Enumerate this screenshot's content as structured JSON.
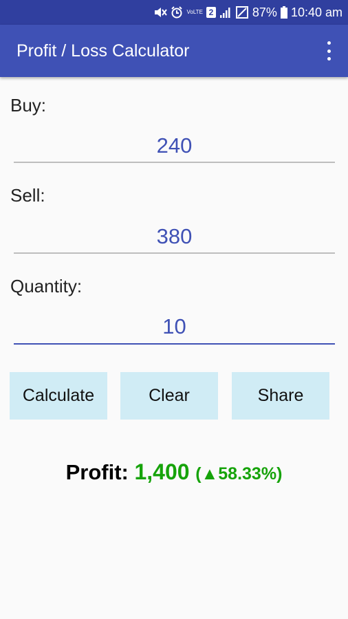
{
  "status_bar": {
    "battery": "87%",
    "time": "10:40 am",
    "lte_label": "VoLTE",
    "sim_badge": "2",
    "icons": [
      "mute-icon",
      "alarm-icon",
      "volte-icon",
      "sim-icon",
      "signal-icon",
      "no-sim-icon",
      "battery-icon"
    ]
  },
  "app_bar": {
    "title": "Profit / Loss Calculator",
    "menu_icon": "overflow-menu-icon"
  },
  "form": {
    "buy_label": "Buy:",
    "buy_value": "240",
    "sell_label": "Sell:",
    "sell_value": "380",
    "quantity_label": "Quantity:",
    "quantity_value": "10"
  },
  "buttons": {
    "calculate": "Calculate",
    "clear": "Clear",
    "share": "Share"
  },
  "result": {
    "label": "Profit:",
    "amount": "1,400",
    "open_paren": "(",
    "arrow": "▲",
    "percent": "58.33%",
    "close_paren": ")"
  },
  "colors": {
    "status_bar": "#303f9f",
    "app_bar": "#3f51b5",
    "accent": "#3f51b5",
    "button_bg": "#d0ecf5",
    "profit_green": "#16a30a"
  }
}
